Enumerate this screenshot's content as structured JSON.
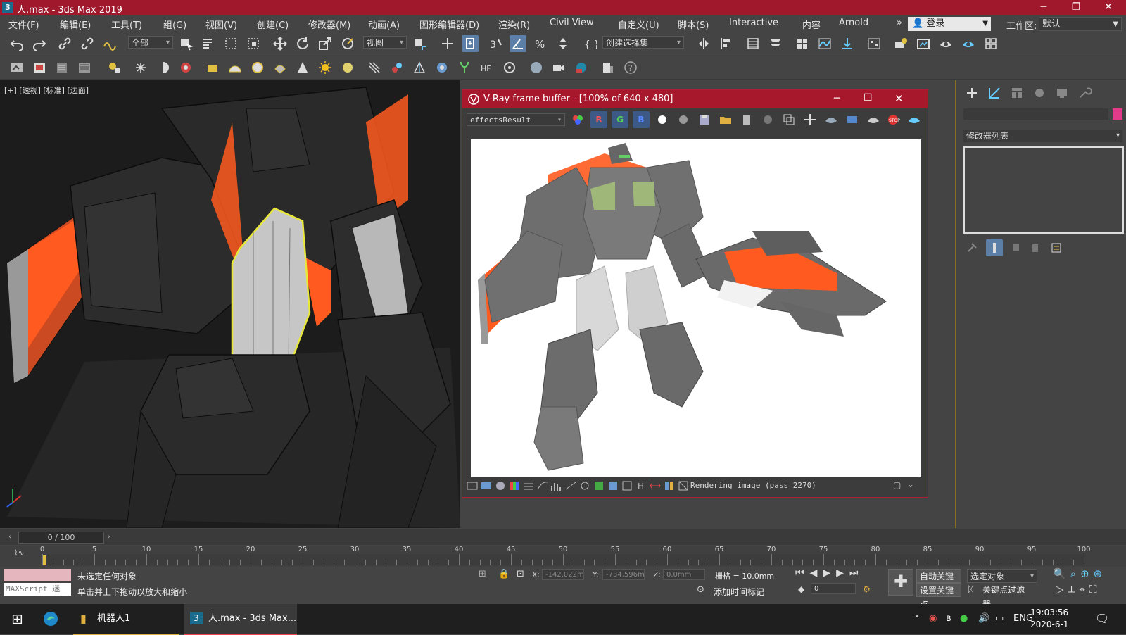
{
  "window": {
    "app_icon": "3",
    "title": "人.max - 3ds Max 2019",
    "controls": {
      "minimize": "─",
      "restore": "❐",
      "close": "✕"
    }
  },
  "menubar": {
    "items": [
      "文件(F)",
      "编辑(E)",
      "工具(T)",
      "组(G)",
      "视图(V)",
      "创建(C)",
      "修改器(M)",
      "动画(A)",
      "图形编辑器(D)",
      "渲染(R)",
      "Civil View",
      "自定义(U)",
      "脚本(S)",
      "Interactive",
      "内容",
      "Arnold"
    ],
    "overflow": "»",
    "login": "登录",
    "workspace_label": "工作区:",
    "workspace_value": "默认"
  },
  "toolbar": {
    "selection_filter": "全部",
    "ref_coord": "视图",
    "named_selection": "创建选择集"
  },
  "viewport": {
    "label": "[+] [透视] [标准] [边面]"
  },
  "vfb": {
    "title": "V-Ray frame buffer - [100% of 640 x 480]",
    "channel": "effectsResult",
    "channel_buttons": [
      "R",
      "G",
      "B"
    ],
    "status": "Rendering image (pass 2270)"
  },
  "command_panel": {
    "modifier_list": "修改器列表"
  },
  "timeline": {
    "frame_display": "0 / 100",
    "ticks": [
      "0",
      "5",
      "10",
      "15",
      "20",
      "25",
      "30",
      "35",
      "40",
      "45",
      "50",
      "55",
      "60",
      "65",
      "70",
      "75",
      "80",
      "85",
      "90",
      "95",
      "100"
    ]
  },
  "statusbar": {
    "maxscript": "MAXScript 迷",
    "selection_status": "未选定任何对象",
    "prompt": "单击并上下拖动以放大和缩小",
    "x_label": "X:",
    "x_value": "-142.022m",
    "y_label": "Y:",
    "y_value": "-734.596m",
    "z_label": "Z:",
    "z_value": "0.0mm",
    "grid": "栅格 = 10.0mm",
    "add_time_tag": "添加时间标记",
    "auto_key": "自动关键点",
    "set_key": "设置关键点",
    "key_mode": "选定对象",
    "key_filters": "关键点过滤器...",
    "current_frame": "0"
  },
  "taskbar": {
    "apps": [
      "机器人1",
      "人.max - 3ds Max..."
    ],
    "lang": "ENG",
    "time": "19:03:56",
    "date": "2020-6-1"
  },
  "colors": {
    "title_red": "#a0182c",
    "accent_blue": "#5b7fa6",
    "selection_yellow": "#e8e83a",
    "robot_orange": "#ff5a1f"
  }
}
